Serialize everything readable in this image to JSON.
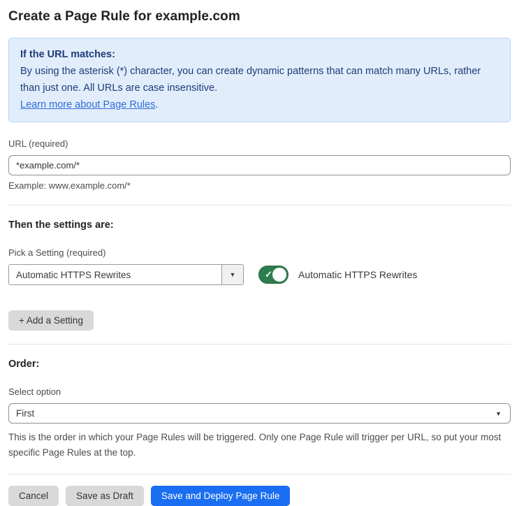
{
  "page": {
    "title": "Create a Page Rule for example.com"
  },
  "info_box": {
    "heading": "If the URL matches:",
    "body": "By using the asterisk (*) character, you can create dynamic patterns that can match many URLs, rather than just one. All URLs are case insensitive.",
    "link_label": "Learn more about Page Rules",
    "link_suffix": "."
  },
  "url_field": {
    "label": "URL (required)",
    "value": "*example.com/*",
    "helper": "Example: www.example.com/*"
  },
  "settings_section": {
    "heading": "Then the settings are:",
    "picker_label": "Pick a Setting (required)",
    "selected_setting": "Automatic HTTPS Rewrites",
    "toggle_state": "on",
    "toggle_label": "Automatic HTTPS Rewrites",
    "add_button_label": "+ Add a Setting"
  },
  "order_section": {
    "heading": "Order:",
    "select_label": "Select option",
    "selected_option": "First",
    "helper": "This is the order in which your Page Rules will be triggered. Only one Page Rule will trigger per URL, so put your most specific Page Rules at the top."
  },
  "footer": {
    "cancel_label": "Cancel",
    "save_draft_label": "Save as Draft",
    "deploy_label": "Save and Deploy Page Rule"
  },
  "icons": {
    "dropdown_caret": "▼",
    "toggle_check": "✓"
  },
  "colors": {
    "accent_blue": "#1a6ef2",
    "info_bg": "#e2edfb",
    "info_border": "#b9d4f3",
    "info_text": "#1e3c78",
    "link_blue": "#2f6bd8",
    "toggle_green": "#2d7d4e",
    "button_gray": "#d9d9d9"
  }
}
